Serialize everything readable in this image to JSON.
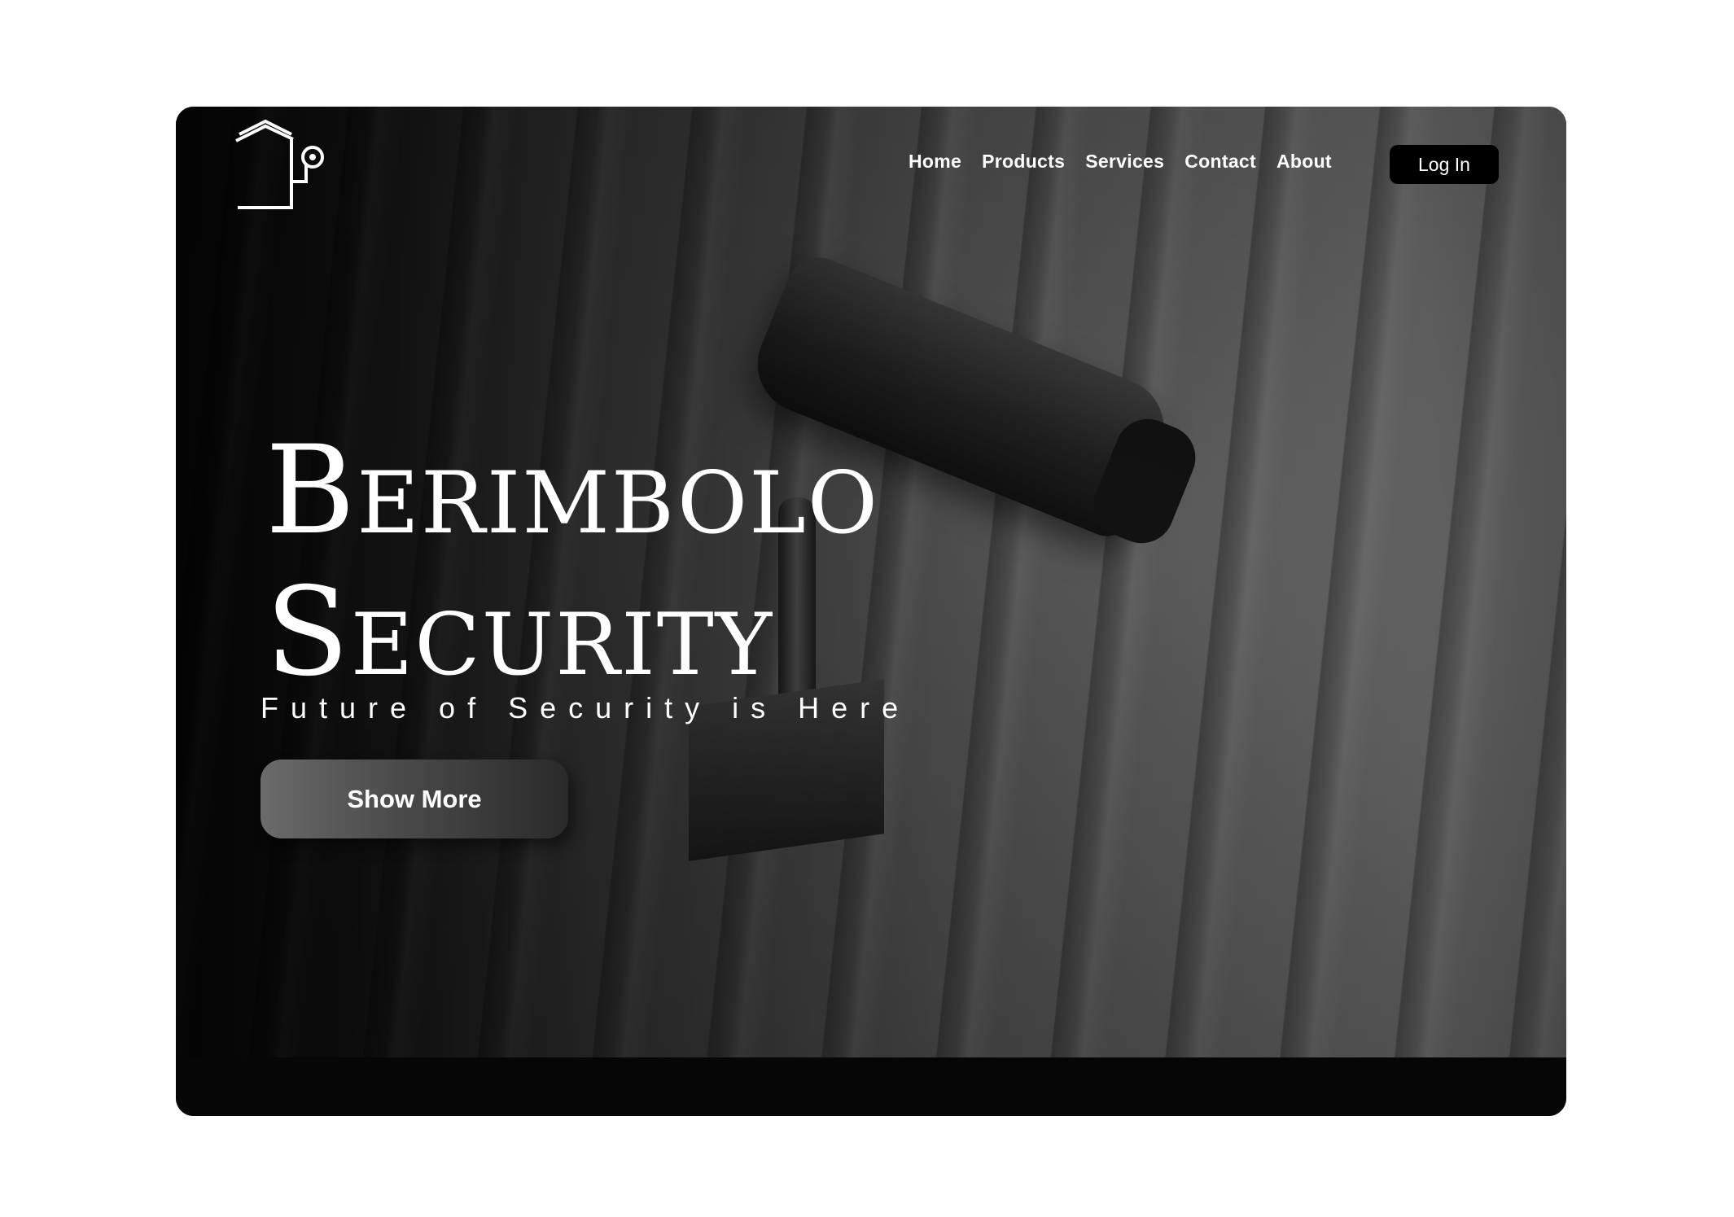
{
  "nav": {
    "items": [
      {
        "label": "Home"
      },
      {
        "label": "Products"
      },
      {
        "label": "Services"
      },
      {
        "label": "Contact"
      },
      {
        "label": "About"
      }
    ],
    "login_label": "Log In"
  },
  "hero": {
    "title_line1": "Berimbolo",
    "title_line2": "Security",
    "subtitle": "Future of Security is Here",
    "cta_label": "Show More"
  },
  "logo": {
    "icon": "house-camera-icon"
  },
  "colors": {
    "page_bg": "#ffffff",
    "frame_bg": "#060606",
    "text": "#ffffff",
    "login_bg": "#000000"
  }
}
